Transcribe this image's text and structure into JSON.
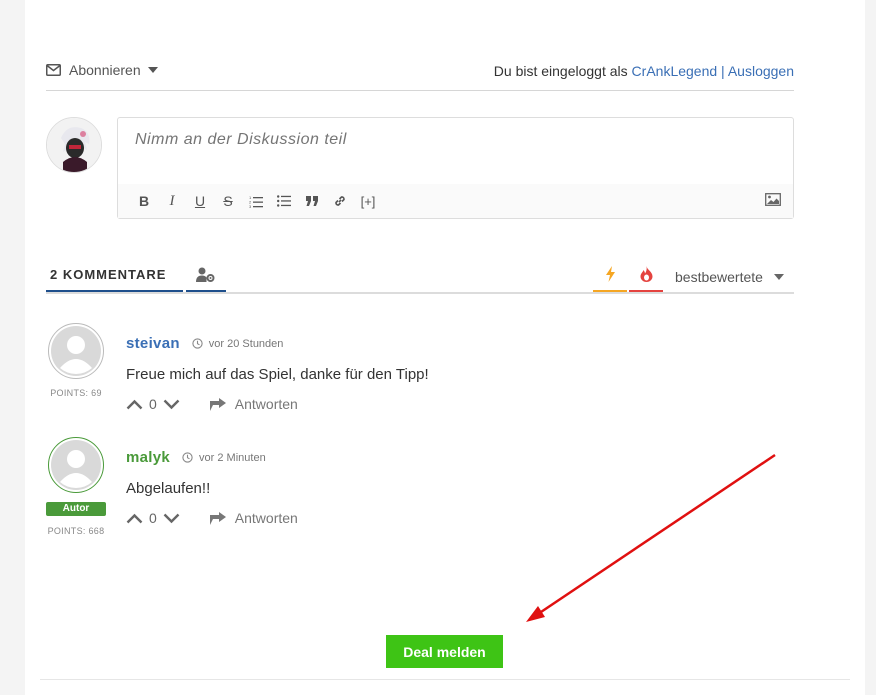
{
  "header": {
    "subscribe_label": "Abonnieren",
    "login_prefix": "Du bist eingeloggt als ",
    "username": "CrAnkLegend",
    "separator": " | ",
    "logout_label": "Ausloggen"
  },
  "editor": {
    "placeholder": "Nimm an der Diskussion teil",
    "toolbar": {
      "bold": "B",
      "italic": "I",
      "underline": "U",
      "strike": "S",
      "spoiler": "[+]"
    }
  },
  "tabs": {
    "count_label": "2 KOMMENTARE",
    "sort_label": "bestbewertete",
    "colors": {
      "active": "#1e4f8c",
      "hot": "#f5a623",
      "fire": "#e4433f"
    }
  },
  "comments": [
    {
      "author": "steivan",
      "time": "vor 20 Stunden",
      "text": "Freue mich auf das Spiel, danke für den Tipp!",
      "points": "POINTS: 69",
      "votes": "0",
      "reply_label": "Antworten"
    },
    {
      "author": "malyk",
      "time": "vor 2 Minuten",
      "text": "Abgelaufen!!",
      "badge": "Autor",
      "points": "POINTS: 668",
      "votes": "0",
      "reply_label": "Antworten"
    }
  ],
  "report_button": "Deal melden",
  "colors": {
    "report_green": "#3ec415",
    "link_blue": "#3a6fb5",
    "author_green": "#4a9a3a",
    "arrow_red": "#e01010"
  }
}
